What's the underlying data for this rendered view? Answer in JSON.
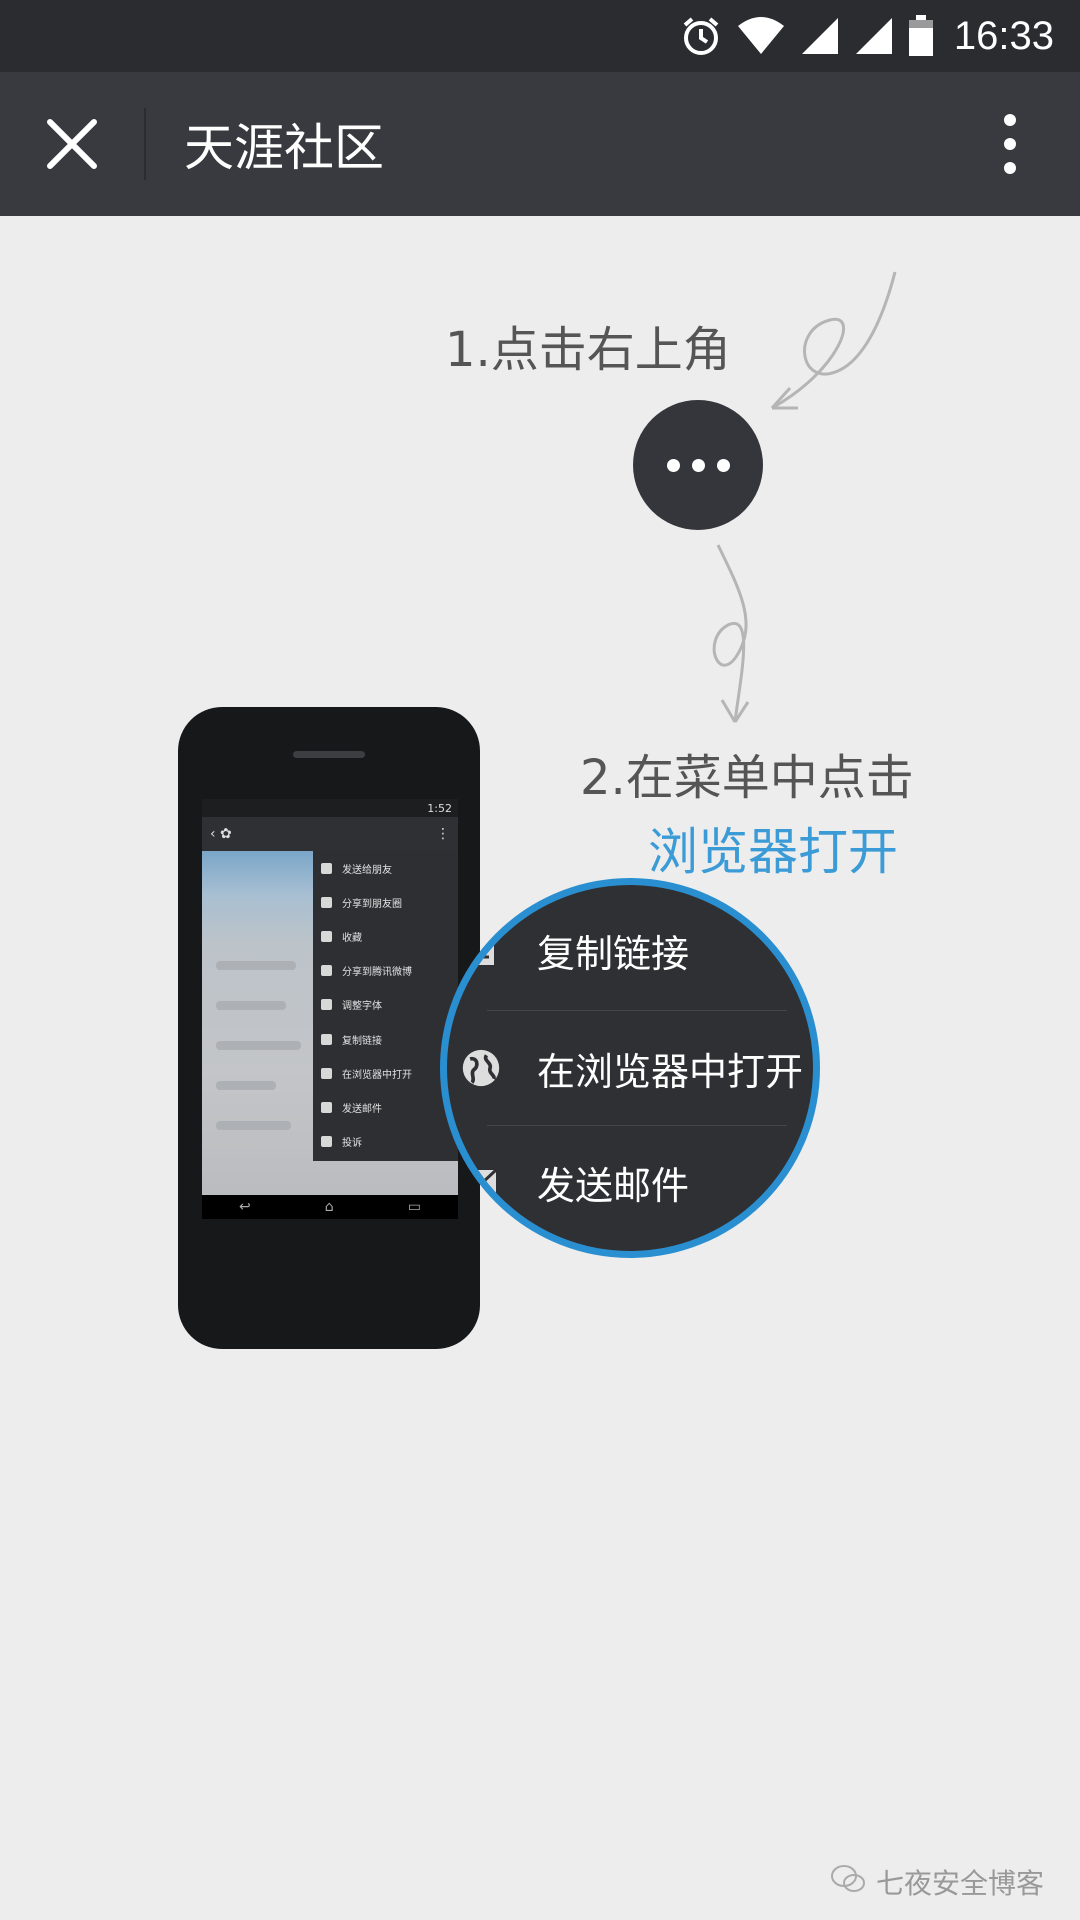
{
  "status_bar": {
    "time": "16:33",
    "icons": [
      "alarm-icon",
      "wifi-icon",
      "signal-icon",
      "signal-icon",
      "battery-icon"
    ]
  },
  "title_bar": {
    "title": "天涯社区",
    "close_icon": "close-icon",
    "more_icon": "more-vertical-icon"
  },
  "guide": {
    "step1": "1.点击右上角",
    "step2": "2.在菜单中点击",
    "step2_highlight": "浏览器打开",
    "highlight_color": "#3a9bd6"
  },
  "phone_mockup": {
    "status_time": "1:52",
    "menu_items": [
      {
        "label": "发送给朋友",
        "icon": "share-icon"
      },
      {
        "label": "分享到朋友圈",
        "icon": "moments-icon"
      },
      {
        "label": "收藏",
        "icon": "favorite-icon"
      },
      {
        "label": "分享到腾讯微博",
        "icon": "weibo-icon"
      },
      {
        "label": "调整字体",
        "icon": "font-icon"
      },
      {
        "label": "复制链接",
        "icon": "copy-icon"
      },
      {
        "label": "在浏览器中打开",
        "icon": "globe-icon"
      },
      {
        "label": "发送邮件",
        "icon": "mail-icon"
      },
      {
        "label": "投诉",
        "icon": "warning-icon"
      }
    ]
  },
  "magnifier": {
    "items": [
      {
        "label": "复制链接",
        "icon": "copy-icon"
      },
      {
        "label": "在浏览器中打开",
        "icon": "globe-icon"
      },
      {
        "label": "发送邮件",
        "icon": "mail-icon"
      }
    ],
    "border_color": "#2a8fd0"
  },
  "watermark": {
    "text": "七夜安全博客"
  }
}
